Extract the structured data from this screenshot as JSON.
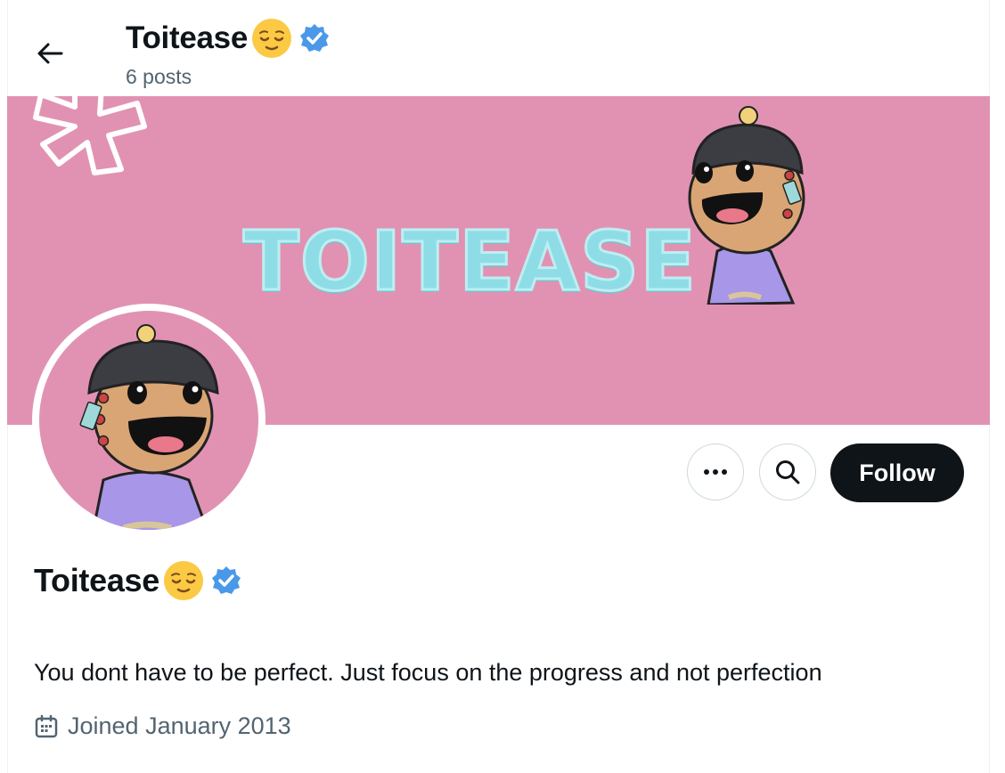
{
  "header": {
    "display_name": "Toitease",
    "post_count": "6 posts"
  },
  "banner": {
    "title_text": "TOITEASE",
    "color": "#e192b2",
    "title_color": "#8edde6"
  },
  "actions": {
    "more_icon": "more-icon",
    "search_icon": "search-icon",
    "follow_label": "Follow"
  },
  "profile": {
    "display_name": "Toitease",
    "emoji": "relieved-face-emoji",
    "verified": true,
    "bio": "You dont have to be perfect. Just focus on the progress and not perfection",
    "joined": "Joined January 2013"
  },
  "colors": {
    "accent_verified": "#4a99e9",
    "text_primary": "#0f1419",
    "text_secondary": "#536471"
  }
}
